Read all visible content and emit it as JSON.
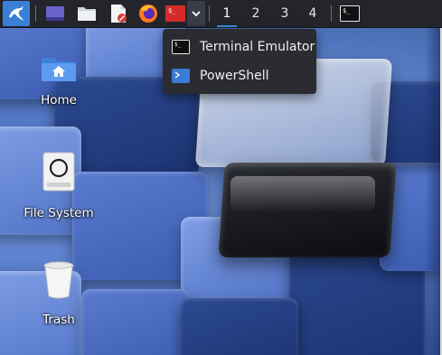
{
  "taskbar": {
    "launchers": [
      {
        "name": "kali-menu",
        "icon": "kali-dragon-icon"
      },
      {
        "name": "show-desktop",
        "icon": "desktop-icon"
      },
      {
        "name": "file-manager",
        "icon": "folder-icon"
      },
      {
        "name": "text-editor",
        "icon": "text-editor-icon"
      },
      {
        "name": "firefox",
        "icon": "firefox-icon"
      },
      {
        "name": "terminal",
        "icon": "terminal-icon"
      }
    ],
    "workspaces": [
      "1",
      "2",
      "3",
      "4"
    ],
    "active_workspace": "1",
    "running_window_icon": "terminal-icon"
  },
  "terminal_menu": {
    "items": [
      {
        "label": "Terminal Emulator",
        "icon": "terminal-icon"
      },
      {
        "label": "PowerShell",
        "icon": "powershell-icon"
      }
    ]
  },
  "desktop": {
    "icons": [
      {
        "label": "Home",
        "icon": "home-folder-icon"
      },
      {
        "label": "File System",
        "icon": "hard-drive-icon"
      },
      {
        "label": "Trash",
        "icon": "trash-icon"
      }
    ]
  },
  "colors": {
    "taskbar_bg": "#23252b",
    "menu_bg": "#2a2c31",
    "accent": "#3c8ee6",
    "terminal_red": "#d62b2b",
    "powershell_blue": "#3a7bd5"
  }
}
